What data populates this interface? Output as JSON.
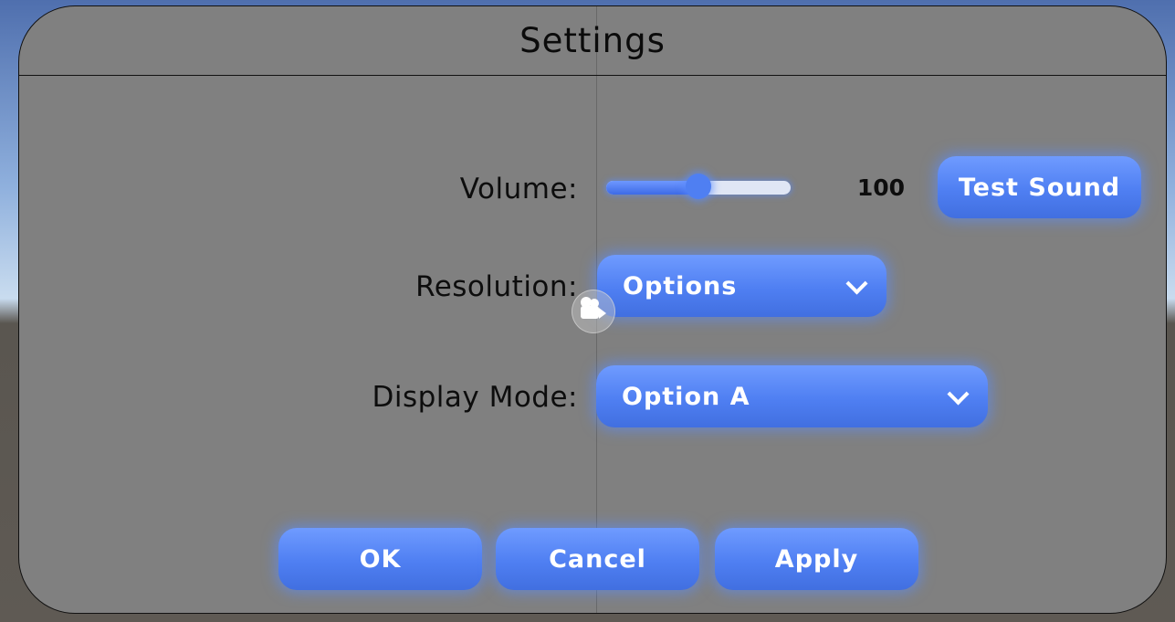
{
  "window": {
    "title": "Settings"
  },
  "volume": {
    "label": "Volume:",
    "value_text": "100",
    "slider_fraction": 0.5
  },
  "test_sound": {
    "label": "Test Sound"
  },
  "resolution": {
    "label": "Resolution:",
    "selected": "Options"
  },
  "display_mode": {
    "label": "Display Mode:",
    "selected": "Option A"
  },
  "actions": {
    "ok": "OK",
    "cancel": "Cancel",
    "apply": "Apply"
  },
  "colors": {
    "panel": "#808080",
    "accent": "#4f7ff2",
    "text": "#0d0d0d"
  },
  "icons": {
    "dropdown": "chevron-down-icon",
    "scene_camera": "camera-icon"
  }
}
